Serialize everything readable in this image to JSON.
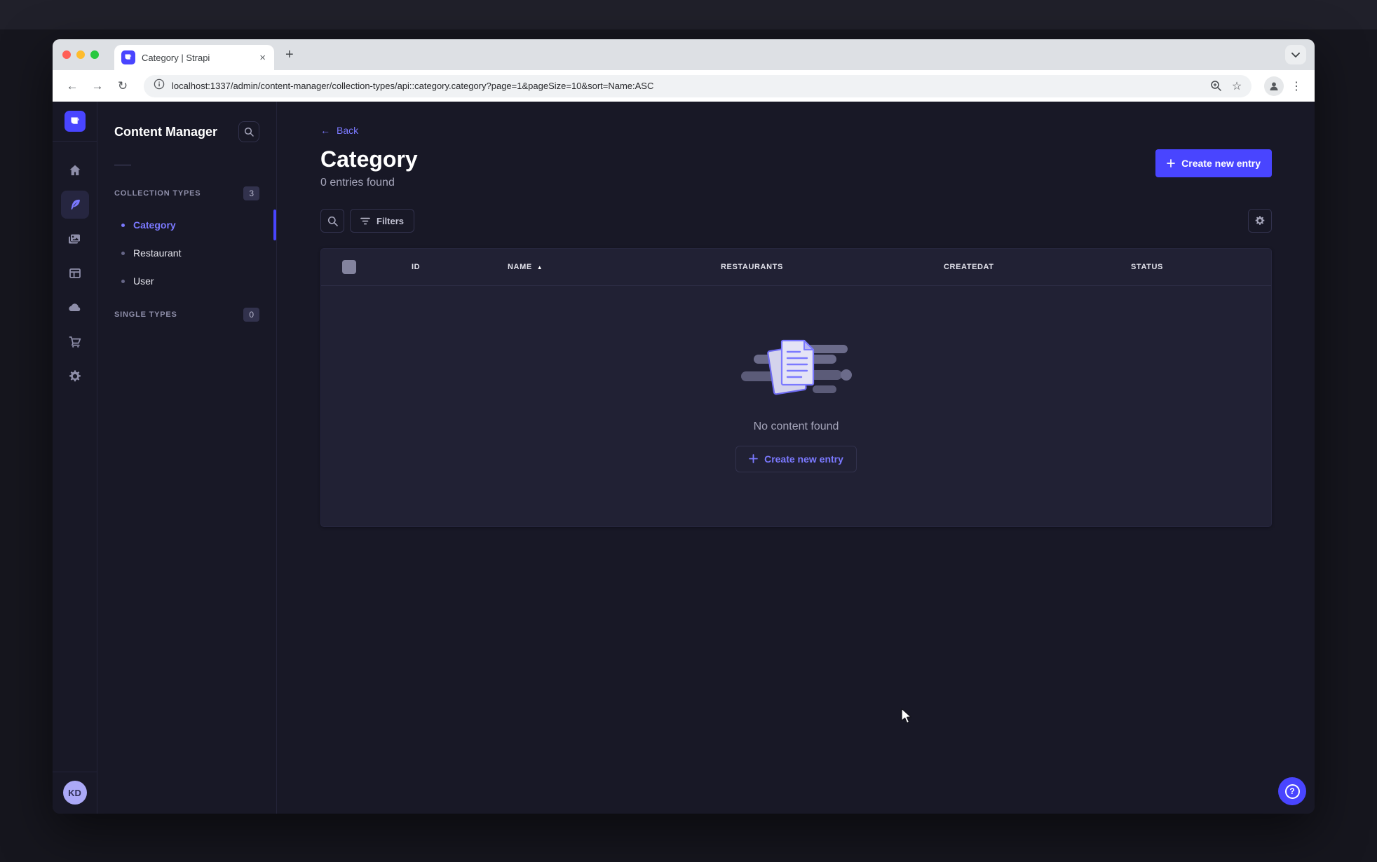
{
  "browser": {
    "tab_title": "Category | Strapi",
    "url": "localhost:1337/admin/content-manager/collection-types/api::category.category?page=1&pageSize=10&sort=Name:ASC"
  },
  "icons": {
    "close": "×",
    "plus": "+",
    "back_arrow": "←",
    "forward_arrow": "→",
    "reload": "↻",
    "star": "☆",
    "dots": "⋮",
    "sort_asc": "▲",
    "help": "?",
    "sidebar": [
      "home",
      "content-manager",
      "media-library",
      "content-type-builder",
      "cloud",
      "marketplace",
      "settings"
    ]
  },
  "user": {
    "initials": "KD"
  },
  "subnav": {
    "title": "Content Manager",
    "sections": [
      {
        "label": "COLLECTION TYPES",
        "badge": "3"
      },
      {
        "label": "SINGLE TYPES",
        "badge": "0"
      }
    ],
    "items": [
      {
        "label": "Category",
        "active": true
      },
      {
        "label": "Restaurant",
        "active": false
      },
      {
        "label": "User",
        "active": false
      }
    ]
  },
  "main": {
    "back": "Back",
    "title": "Category",
    "subtitle": "0 entries found",
    "create_button": "Create new entry",
    "filters": "Filters",
    "columns": [
      "ID",
      "NAME",
      "RESTAURANTS",
      "CREATEDAT",
      "STATUS"
    ],
    "sorted_column": "NAME",
    "empty_message": "No content found",
    "empty_create_button": "Create new entry"
  },
  "colors": {
    "primary": "#4945ff",
    "primary_light": "#7b79ff",
    "app_bg": "#181826",
    "card_bg": "#212134",
    "border": "#32324d",
    "text_muted": "#a5a5ba"
  }
}
